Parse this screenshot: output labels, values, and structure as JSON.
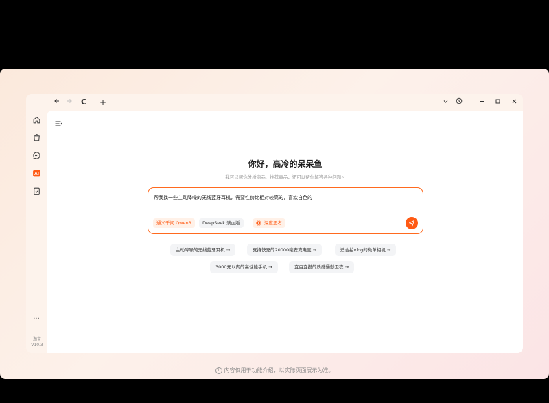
{
  "browser": {
    "back_icon": "arrow-left-icon",
    "forward_icon": "arrow-right-icon",
    "reload_label": "C",
    "new_tab_label": "+",
    "window_controls": [
      "chevron-down-icon",
      "history-icon",
      "minimize-icon",
      "maximize-icon",
      "close-icon"
    ]
  },
  "sidebar": {
    "items": [
      {
        "name": "home",
        "icon": "home-icon"
      },
      {
        "name": "cart",
        "icon": "shopping-bag-icon"
      },
      {
        "name": "message",
        "icon": "chat-icon"
      },
      {
        "name": "ai",
        "icon": "ai-icon",
        "label": "AI",
        "active": true
      },
      {
        "name": "clipboard",
        "icon": "clipboard-check-icon"
      }
    ],
    "more_label": "···",
    "version_line1": "淘宝",
    "version_line2": "V10.3"
  },
  "main": {
    "greeting": "你好，高冷的呆呆鱼",
    "subtitle": "我可以帮你分析商品、推荐商品，还可以帮你解答各种问题~",
    "input_text": "帮我找一些主动降噪的无线蓝牙耳机，需要性价比相对较高的，喜欢白色的",
    "model_chip": "通义千问 Qwen3",
    "deepseek_chip": "DeepSeek 满血版",
    "think_chip": "深度思考",
    "suggestions": [
      "主动降噪的无线蓝牙耳机 →",
      "支持快充的20000毫安充电宝 →",
      "适合拍vlog的微单相机 →",
      "3000元以内的高性能手机 →",
      "宜白宜搭的质感通勤卫衣 →"
    ]
  },
  "footer": {
    "note": "内容仅用于功能介绍，以实际页面展示为准。"
  },
  "colors": {
    "accent": "#ff5a14",
    "frame_bg": "#fdf1ea"
  }
}
